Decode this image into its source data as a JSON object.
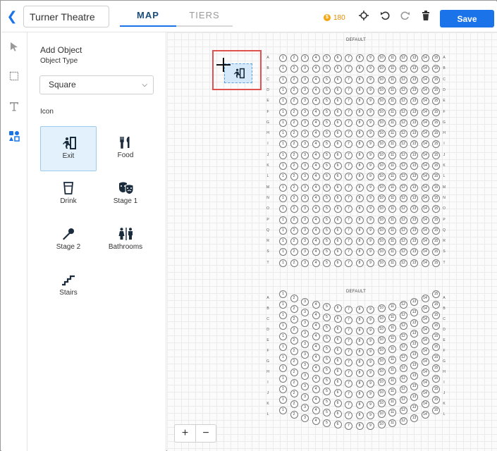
{
  "header": {
    "venue_name": "Turner Theatre",
    "tabs": [
      {
        "label": "MAP"
      },
      {
        "label": "TIERS"
      }
    ],
    "coins": "180",
    "save_label": "Save",
    "back_icon": "chevron-left-icon",
    "tool_icons": [
      "crosshair-icon",
      "undo-icon",
      "redo-icon",
      "trash-icon"
    ]
  },
  "rail": {
    "tools": [
      "pointer-icon",
      "rectangle-icon",
      "text-icon",
      "shapes-icon"
    ]
  },
  "panel": {
    "title": "Add Object",
    "object_type_label": "Object Type",
    "object_type_value": "Square",
    "icon_label": "Icon",
    "icons": [
      {
        "label": "Exit",
        "icon": "exit-icon",
        "selected": true
      },
      {
        "label": "Food",
        "icon": "food-icon"
      },
      {
        "label": "Drink",
        "icon": "drink-icon"
      },
      {
        "label": "Stage 1",
        "icon": "theater-masks-icon"
      },
      {
        "label": "Stage 2",
        "icon": "microphone-icon"
      },
      {
        "label": "Bathrooms",
        "icon": "restroom-icon"
      },
      {
        "label": "Stairs",
        "icon": "stairs-icon"
      }
    ]
  },
  "canvas": {
    "sections": [
      {
        "label": "DEFAULT",
        "rows": [
          "A",
          "B",
          "C",
          "D",
          "E",
          "F",
          "G",
          "H",
          "I",
          "J",
          "K",
          "L",
          "M",
          "N",
          "O",
          "P",
          "Q",
          "R",
          "S",
          "T"
        ],
        "seats_per_row": 15,
        "curved": false
      },
      {
        "label": "DEFAULT",
        "rows": [
          "A",
          "B",
          "C",
          "D",
          "E",
          "F",
          "G",
          "H",
          "I",
          "J",
          "K",
          "L"
        ],
        "seats_per_row": 15,
        "curved": true
      }
    ],
    "zoom_in": "+",
    "zoom_out": "−"
  }
}
